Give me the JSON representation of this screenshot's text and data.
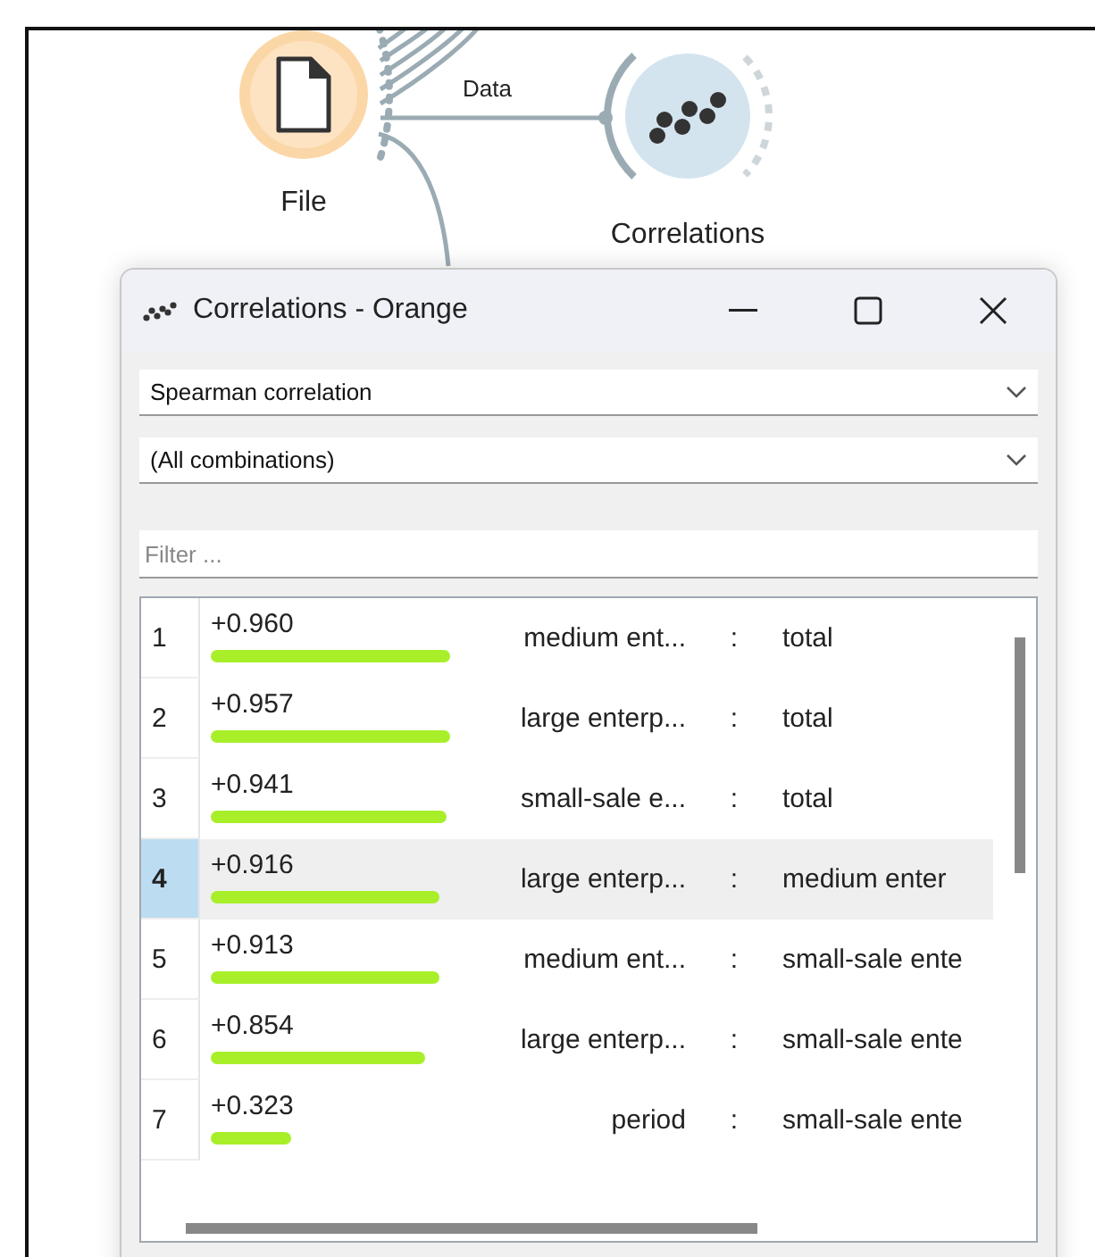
{
  "canvas": {
    "nodes": [
      {
        "kind": "file",
        "label": "File"
      },
      {
        "kind": "correlations",
        "label": "Correlations"
      }
    ],
    "link_label": "Data"
  },
  "window": {
    "title": "Correlations - Orange",
    "method": {
      "value": "Spearman correlation"
    },
    "feature": {
      "value": "(All combinations)"
    },
    "filter": {
      "placeholder": "Filter ..."
    },
    "table": {
      "rows": [
        {
          "index": "1",
          "value": "+0.960",
          "attr1": "medium ent...",
          "sep": ":",
          "attr2": "total",
          "selected": false
        },
        {
          "index": "2",
          "value": "+0.957",
          "attr1": "large enterp...",
          "sep": ":",
          "attr2": "total",
          "selected": false
        },
        {
          "index": "3",
          "value": "+0.941",
          "attr1": "small-sale e...",
          "sep": ":",
          "attr2": "total",
          "selected": false
        },
        {
          "index": "4",
          "value": "+0.916",
          "attr1": "large enterp...",
          "sep": ":",
          "attr2": "medium enter",
          "selected": true
        },
        {
          "index": "5",
          "value": "+0.913",
          "attr1": "medium ent...",
          "sep": ":",
          "attr2": "small-sale ente",
          "selected": false
        },
        {
          "index": "6",
          "value": "+0.854",
          "attr1": "large enterp...",
          "sep": ":",
          "attr2": "small-sale ente",
          "selected": false
        },
        {
          "index": "7",
          "value": "+0.323",
          "attr1": "period",
          "sep": ":",
          "attr2": "small-sale ente",
          "selected": false
        }
      ]
    }
  }
}
